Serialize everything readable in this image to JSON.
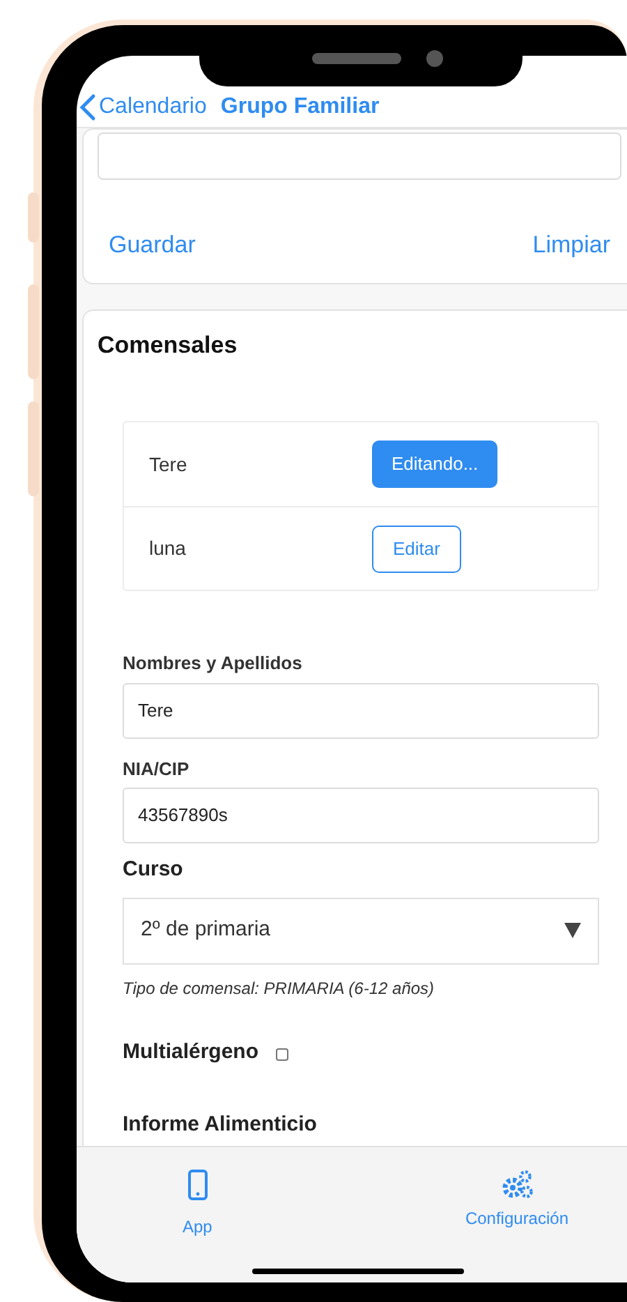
{
  "nav": {
    "back_label": "Calendario",
    "title": "Grupo Familiar"
  },
  "top_card": {
    "buttons": [
      "Guardar",
      "Limpiar"
    ]
  },
  "comensales": {
    "title": "Comensales",
    "rows": [
      {
        "name": "Tere",
        "button": "Editando...",
        "selected": true
      },
      {
        "name": "luna",
        "button": "Editar",
        "selected": false
      }
    ]
  },
  "fields": [
    {
      "kind": "text",
      "label": "Nombres y Apellidos",
      "value": "Tere"
    },
    {
      "kind": "text",
      "label": "NIA/CIP",
      "value": "43567890s"
    },
    {
      "kind": "select",
      "label": "Curso",
      "value": "2º de primaria"
    }
  ],
  "note": "Tipo de comensal: PRIMARIA (6-12 años)",
  "multialergeno": {
    "label": "Multialérgeno",
    "checked": false
  },
  "informe": {
    "title": "Informe Alimenticio"
  },
  "tab_bar": [
    {
      "label": "App"
    },
    {
      "label": "Configuración"
    }
  ]
}
